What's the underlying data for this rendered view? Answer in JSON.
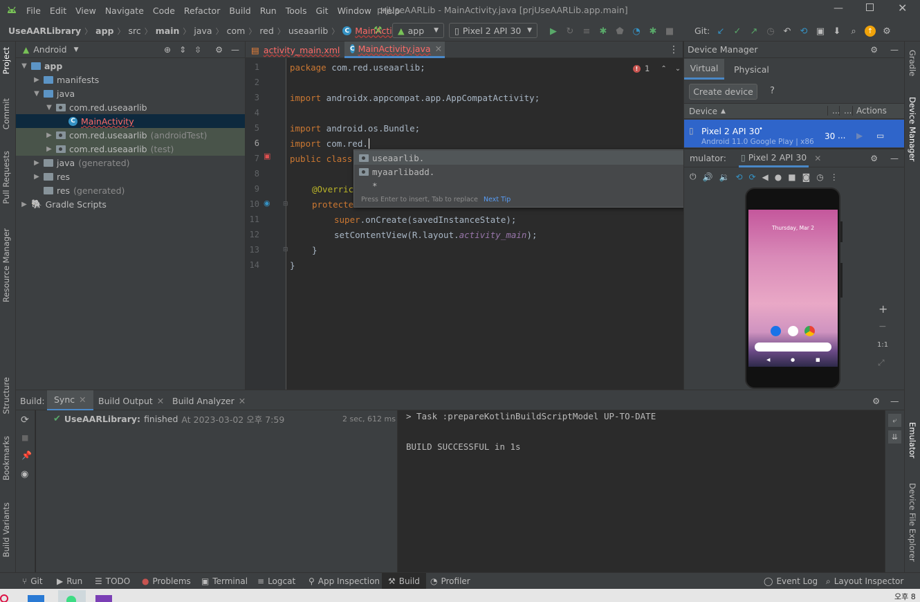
{
  "menu": {
    "items": [
      "File",
      "Edit",
      "View",
      "Navigate",
      "Code",
      "Refactor",
      "Build",
      "Run",
      "Tools",
      "Git",
      "Window",
      "Help"
    ],
    "window_title": "prjUseAARLib - MainActivity.java [prjUseAARLib.app.main]"
  },
  "breadcrumb": {
    "items": [
      "UseAARLibrary",
      "app",
      "src",
      "main",
      "java",
      "com",
      "red",
      "useaarlib",
      "MainActivity"
    ]
  },
  "toolbar": {
    "run_config": "app",
    "device": "Pixel 2 API 30",
    "git_label": "Git:"
  },
  "project": {
    "view_mode": "Android",
    "tree": [
      {
        "label": "app",
        "extra": ""
      },
      {
        "label": "manifests",
        "extra": ""
      },
      {
        "label": "java",
        "extra": ""
      },
      {
        "label": "com.red.useaarlib",
        "extra": ""
      },
      {
        "label": "MainActivity",
        "extra": ""
      },
      {
        "label": "com.red.useaarlib",
        "extra": "(androidTest)"
      },
      {
        "label": "com.red.useaarlib",
        "extra": "(test)"
      },
      {
        "label": "java",
        "extra": "(generated)"
      },
      {
        "label": "res",
        "extra": ""
      },
      {
        "label": "res",
        "extra": "(generated)"
      },
      {
        "label": "Gradle Scripts",
        "extra": ""
      }
    ]
  },
  "editor": {
    "tabs": [
      "activity_main.xml",
      "MainActivity.java"
    ],
    "error_count": "1",
    "line_numbers": [
      "1",
      "2",
      "3",
      "4",
      "5",
      "6",
      "7",
      "8",
      "9",
      "10",
      "11",
      "12",
      "13",
      "14"
    ],
    "code": {
      "l1_kw": "package",
      "l1_rest": " com.red.useaarlib;",
      "l3_kw": "import",
      "l3_rest": " androidx.appcompat.app.AppCompatActivity;",
      "l5_kw": "import",
      "l5_rest": " android.os.Bundle;",
      "l6_kw": "import",
      "l6_rest": " com.red.",
      "l7_kw": "public class",
      "l9_ann": "@Overric",
      "l10_kw": "protecte",
      "l11_a": "super",
      "l11_b": ".onCreate(savedInstanceState);",
      "l12_a": "setContentView(R.layout.",
      "l12_b": "activity_main",
      "l12_c": ");",
      "l13": "}",
      "l14": "}"
    },
    "completion": {
      "items": [
        "useaarlib.",
        "myaarlibadd.",
        "*"
      ],
      "hint": "Press Enter to insert, Tab to replace",
      "next_tip": "Next Tip"
    }
  },
  "device_manager": {
    "title": "Device Manager",
    "tabs": [
      "Virtual",
      "Physical"
    ],
    "create_button": "Create device",
    "help": "?",
    "columns": [
      "Device",
      "...",
      "...",
      "Actions"
    ],
    "device_name": "Pixel 2 API 30",
    "device_sub": "Android 11.0 Google Play | x86",
    "api": "30",
    "more": "..."
  },
  "emulator": {
    "label": "mulator:",
    "tab": "Pixel 2 API 30",
    "phone_date": "Thursday, Mar 2",
    "zoom_plus": "+",
    "zoom_minus": "−",
    "zoom_ratio": "1:1"
  },
  "build": {
    "label": "Build:",
    "tabs": [
      "Sync",
      "Build Output",
      "Build Analyzer"
    ],
    "result_name": "UseAARLibrary:",
    "result_status": "finished",
    "result_time": "At 2023-03-02 오후 7:59",
    "duration": "2 sec, 612 ms",
    "console_line1": "> Task :prepareKotlinBuildScriptModel UP-TO-DATE",
    "console_line2": "BUILD SUCCESSFUL in 1s"
  },
  "statusbar": {
    "items": [
      "Git",
      "Run",
      "TODO",
      "Problems",
      "Terminal",
      "Logcat",
      "App Inspection",
      "Build",
      "Profiler"
    ],
    "right_items": [
      "Event Log",
      "Layout Inspector"
    ]
  },
  "left_stripe": [
    "Project",
    "Commit",
    "Pull Requests",
    "Resource Manager",
    "Structure",
    "Bookmarks",
    "Build Variants"
  ],
  "right_stripe": [
    "Gradle",
    "Device Manager",
    "Emulator",
    "Device File Explorer"
  ],
  "taskbar": {
    "clock": "오후 8"
  },
  "colors": {
    "accent": "#4a88c7",
    "keyword": "#cc7832",
    "selection": "#0d293e",
    "success": "#4caf50"
  }
}
